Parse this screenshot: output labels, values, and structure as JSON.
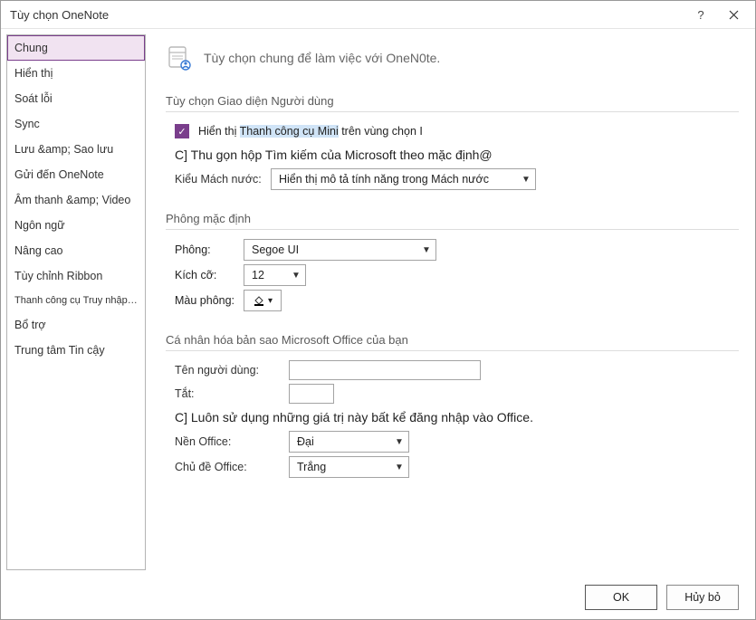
{
  "window": {
    "title": "Tùy chọn OneNote",
    "help_tooltip": "?",
    "close_tooltip": "×"
  },
  "sidebar": {
    "items": [
      "Chung",
      "Hiển thị",
      "Soát lỗi",
      "Sync",
      "Lưu &amp; Sao lưu",
      "Gửi đến OneNote",
      "Âm thanh &amp; Video",
      "Ngôn ngữ",
      "Nâng cao",
      "Tùy chỉnh Ribbon",
      "Thanh công cụ Truy nhập Nhanh",
      "Bổ trợ",
      "Trung tâm Tin cậy"
    ],
    "selected": 0
  },
  "header_lead": "Tùy chọn chung để làm việc với OneN0te.",
  "sections": {
    "ui": {
      "title": "Tùy chọn Giao diện Người dùng",
      "mini_toolbar_pre": "Hiển thị ",
      "mini_toolbar_mid": "Thanh công cụ Mini",
      "mini_toolbar_post": " trên vùng chọn I",
      "collapse_search": "C] Thu gọn hộp Tìm kiếm của Microsoft theo mặc định@",
      "screentip_label": "Kiểu Mách nước:",
      "screentip_value": "Hiển thị mô tả tính năng trong Mách nước"
    },
    "font": {
      "title": "Phông mặc định",
      "font_label": "Phông:",
      "font_value": "Segoe UI",
      "size_label": "Kích cỡ:",
      "size_value": "12",
      "color_label": "Màu phông:"
    },
    "personalize": {
      "title": "Cá nhân hóa bản sao Microsoft Office của bạn",
      "username_label": "Tên người dùng:",
      "initials_label": "Tắt:",
      "always_use": "C] Luôn sử dụng những giá trị này bất kể đăng nhập vào Office.",
      "background_label": "Nền Office:",
      "background_value": "Đại",
      "theme_label": "Chủ đề Office:",
      "theme_value": "Trắng"
    }
  },
  "buttons": {
    "ok": "OK",
    "cancel": "Hủy bỏ"
  }
}
